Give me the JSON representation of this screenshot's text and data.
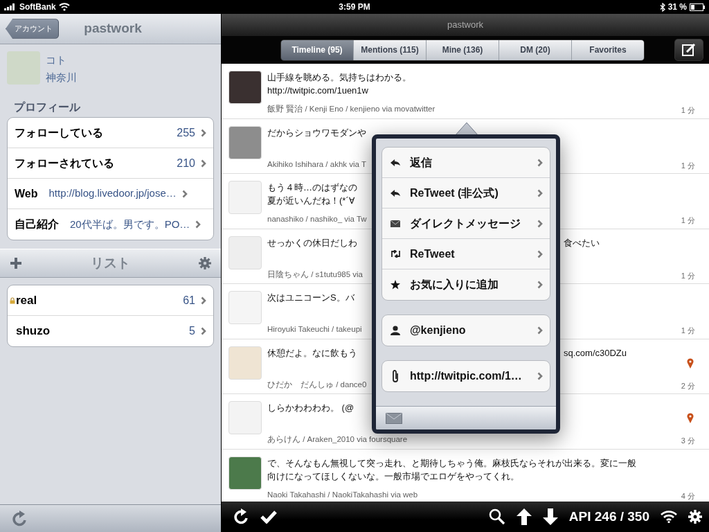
{
  "status_bar": {
    "carrier": "SoftBank",
    "time": "3:59 PM",
    "battery": "31 %"
  },
  "sidebar": {
    "back_button": "アカウント",
    "title": "pastwork",
    "profile": {
      "name": "コト",
      "location": "神奈川"
    },
    "section_title": "プロフィール",
    "profile_rows": [
      {
        "kind": "count",
        "label": "フォローしている",
        "value": "255"
      },
      {
        "kind": "count",
        "label": "フォローされている",
        "value": "210"
      },
      {
        "kind": "detail",
        "label": "Web",
        "value": "http://blog.livedoor.jp/jose…"
      },
      {
        "kind": "detail",
        "label": "自己紹介",
        "value": "20代半ば。男です。PO…"
      }
    ],
    "lists_title": "リスト",
    "lists": [
      {
        "name": "real",
        "count": "61",
        "locked": true
      },
      {
        "name": "shuzo",
        "count": "5",
        "locked": false
      }
    ]
  },
  "main": {
    "title": "pastwork",
    "tabs": [
      {
        "label": "Timeline (95)",
        "selected": true
      },
      {
        "label": "Mentions (115)",
        "selected": false
      },
      {
        "label": "Mine (136)",
        "selected": false
      },
      {
        "label": "DM (20)",
        "selected": false
      },
      {
        "label": "Favorites",
        "selected": false
      }
    ],
    "tweets": [
      {
        "kind": "full",
        "lines": [
          {
            "left": "山手線を眺める。気持ちはわかる。"
          },
          {
            "left": " http://twitpic.com/1uen1w"
          }
        ],
        "meta": "飯野 賢治 / Kenji Eno / kenjieno via movatwitter",
        "time": "1 分",
        "geotagged": false
      },
      {
        "kind": "split",
        "lines": [
          {
            "left": "だからショウワモダンや"
          }
        ],
        "meta": "Akihiko Ishihara / akhk via T",
        "time": "1 分",
        "geotagged": false
      },
      {
        "kind": "split",
        "lines": [
          {
            "left": "もう４時…のはずなの"
          },
          {
            "left": "夏が近いんだね！(*´∀"
          }
        ],
        "meta": "nanashiko / nashiko_ via Tw",
        "time": "1 分",
        "geotagged": false
      },
      {
        "kind": "split",
        "lines": [
          {
            "left": "せっかくの休日だしわ",
            "right": "食べたい"
          }
        ],
        "meta": "日陰ちゃん / s1tutu985 via",
        "time": "1 分",
        "geotagged": false
      },
      {
        "kind": "split",
        "lines": [
          {
            "left": "次はユニコーンS。バ"
          }
        ],
        "meta": "Hiroyuki Takeuchi / takeupi",
        "time": "1 分",
        "geotagged": false
      },
      {
        "kind": "split",
        "lines": [
          {
            "left": "休憩だよ。なに飲もう",
            "right": "sq.com/c30DZu"
          }
        ],
        "meta": "ひだか　だんしゅ / dance0",
        "time": "2 分",
        "geotagged": true
      },
      {
        "kind": "split",
        "lines": [
          {
            "left": "しらかわわわわ。 (@"
          }
        ],
        "meta": "あらけん / Araken_2010 via foursquare",
        "time": "3 分",
        "geotagged": true
      },
      {
        "kind": "full",
        "lines": [
          {
            "left": "で、そんなもん無視して突っ走れ、と期待しちゃう俺。麻枝氏ならそれが出来る。変に一般"
          },
          {
            "left": "向けになってほしくないな。一般市場でエロゲをやってくれ。"
          }
        ],
        "meta": "Naoki Takahashi / NaokiTakahashi via web",
        "time": "4 分",
        "geotagged": false
      }
    ],
    "api": "API 246 / 350"
  },
  "popover": {
    "groups": [
      [
        {
          "kind": "reply",
          "label": "返信"
        },
        {
          "kind": "reply",
          "label": "ReTweet (非公式)"
        },
        {
          "kind": "mail",
          "label": "ダイレクトメッセージ"
        },
        {
          "kind": "retweet",
          "label": "ReTweet"
        },
        {
          "kind": "favorite",
          "label": "お気に入りに追加"
        }
      ],
      [
        {
          "kind": "user",
          "label": "@kenjieno"
        }
      ],
      [
        {
          "kind": "link",
          "label": "http://twitpic.com/1…"
        }
      ]
    ]
  }
}
